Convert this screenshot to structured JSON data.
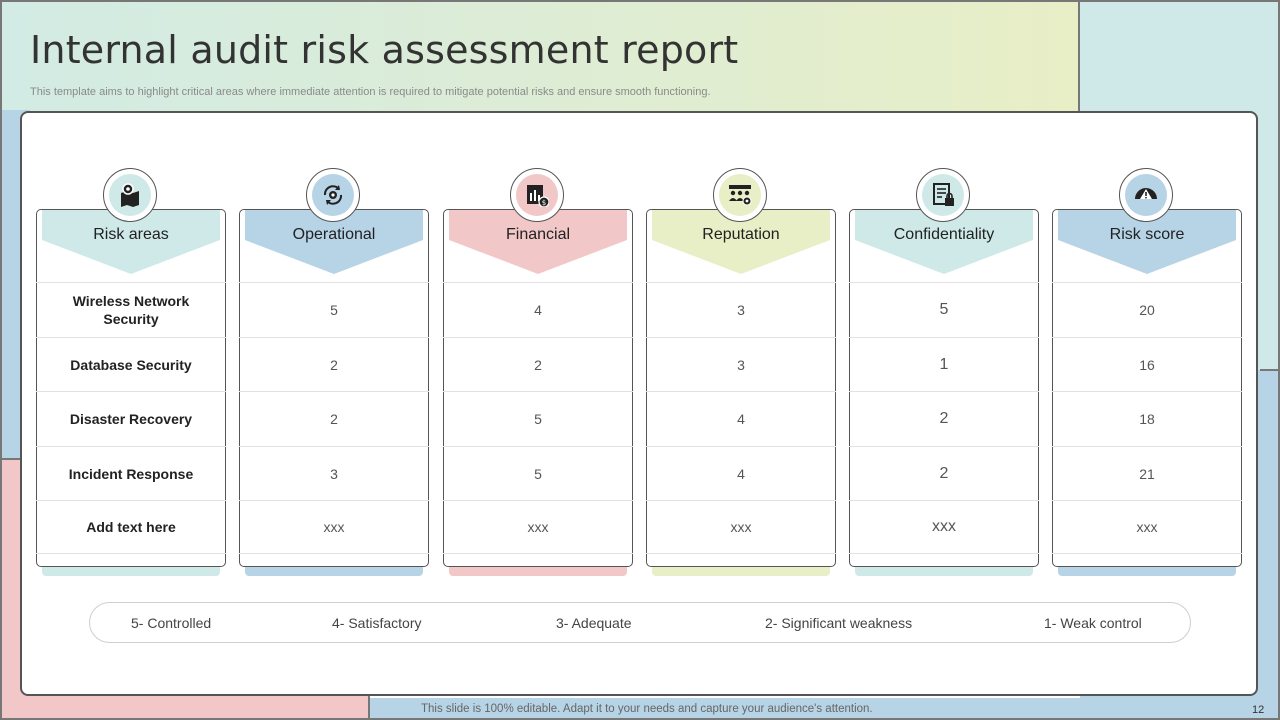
{
  "header": {
    "title": "Internal audit risk assessment report",
    "subtitle": "This template aims to highlight critical areas where immediate attention is required to mitigate potential risks and ensure smooth functioning."
  },
  "colors": {
    "mint": "#cfe9e9",
    "blue": "#b7d3e6",
    "pink": "#f2c7c8",
    "lime": "#e8eec6"
  },
  "table": {
    "columns": [
      {
        "label": "Risk areas",
        "icon": "map-pin-icon",
        "color": "#cfe9e9",
        "cells": [
          "Wireless Network Security",
          "Database Security",
          "Disaster Recovery",
          "Incident Response",
          "Add  text here"
        ]
      },
      {
        "label": "Operational",
        "icon": "gear-cycle-icon",
        "color": "#b7d3e6",
        "cells": [
          "5",
          "2",
          "2",
          "3",
          "xxx"
        ]
      },
      {
        "label": "Financial",
        "icon": "financial-chart-icon",
        "color": "#f2c7c8",
        "cells": [
          "4",
          "2",
          "5",
          "5",
          "xxx"
        ]
      },
      {
        "label": "Reputation",
        "icon": "people-network-icon",
        "color": "#e8eec6",
        "cells": [
          "3",
          "3",
          "4",
          "4",
          "xxx"
        ]
      },
      {
        "label": "Confidentiality",
        "icon": "lock-document-icon",
        "color": "#cfe9e9",
        "cells": [
          "5",
          "1",
          "2",
          "2",
          "xxx"
        ]
      },
      {
        "label": "Risk score",
        "icon": "gauge-warning-icon",
        "color": "#b7d3e6",
        "cells": [
          "20",
          "16",
          "18",
          "21",
          "xxx"
        ]
      }
    ]
  },
  "legend": [
    "5- Controlled",
    "4- Satisfactory",
    "3- Adequate",
    "2- Significant weakness",
    "1- Weak control"
  ],
  "footer": {
    "note": "This slide is 100% editable. Adapt it to your needs and capture your audience's attention.",
    "page": "12"
  }
}
